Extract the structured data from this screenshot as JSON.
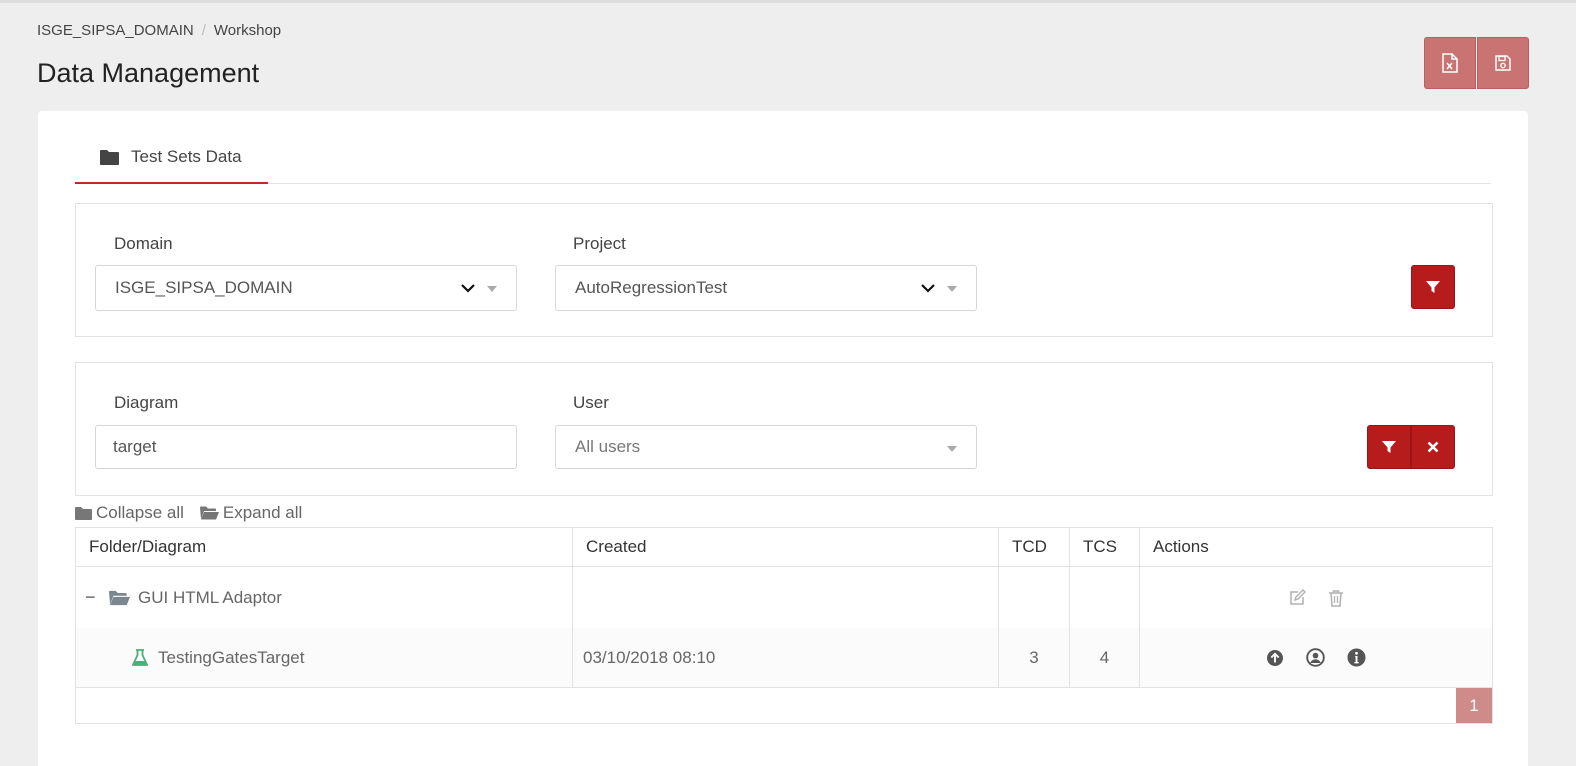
{
  "breadcrumb": {
    "domain": "ISGE_SIPSA_DOMAIN",
    "separator": "/",
    "current": "Workshop"
  },
  "page_title": "Data Management",
  "header_actions": [
    {
      "icon": "excel-file-icon"
    },
    {
      "icon": "save-icon"
    }
  ],
  "tabs": [
    {
      "label": "Test Sets Data",
      "icon": "folder-icon",
      "active": true
    }
  ],
  "filters1": {
    "domain_label": "Domain",
    "domain_value": "ISGE_SIPSA_DOMAIN",
    "project_label": "Project",
    "project_value": "AutoRegressionTest"
  },
  "filters2": {
    "diagram_label": "Diagram",
    "diagram_value": "target",
    "user_label": "User",
    "user_placeholder": "All users"
  },
  "tree_controls": {
    "collapse_label": "Collapse all",
    "expand_label": "Expand all"
  },
  "table": {
    "headers": [
      "Folder/Diagram",
      "Created",
      "TCD",
      "TCS",
      "Actions"
    ],
    "folder": {
      "toggle": "−",
      "name": "GUI HTML Adaptor"
    },
    "rows": [
      {
        "name": "TestingGatesTarget",
        "created": "03/10/2018 08:10",
        "tcd": "3",
        "tcs": "4"
      }
    ]
  },
  "pagination": {
    "current_page": "1"
  },
  "colors": {
    "accent": "#b71c1c",
    "accent_light": "#c97373",
    "test_icon": "#4caf78"
  }
}
